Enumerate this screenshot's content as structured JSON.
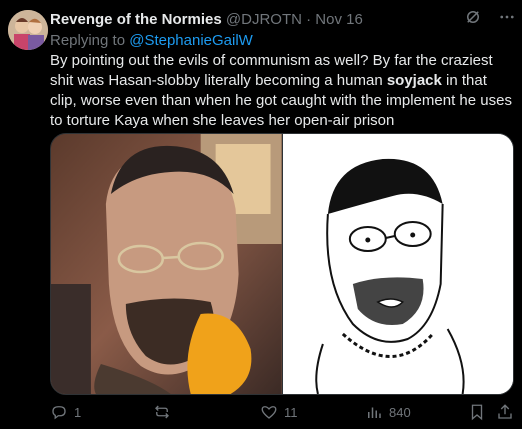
{
  "tweet": {
    "author_name": "Revenge of the Normies",
    "handle": "@DJROTN",
    "separator": "·",
    "date": "Nov 16",
    "reply_prefix": "Replying to",
    "reply_mention": "@StephanieGailW",
    "text_before_bold": "By pointing out the evils of communism as well?  By far the craziest shit was Hasan-slobby literally becoming a human ",
    "text_bold": "soyjack",
    "text_after_bold": " in that clip, worse even than when he got caught with the implement he uses to torture Kaya when she leaves her open-air prison"
  },
  "actions": {
    "replies": "1",
    "reposts": "",
    "likes": "11",
    "views": "840"
  },
  "colors": {
    "background": "#000000",
    "text": "#e7e9ea",
    "muted": "#71767b",
    "accent": "#1d9bf0"
  },
  "icons": {
    "grok": "grok-icon",
    "more": "more-icon",
    "reply": "reply-icon",
    "repost": "repost-icon",
    "like": "like-icon",
    "views": "views-icon",
    "bookmark": "bookmark-icon",
    "share": "share-icon"
  }
}
